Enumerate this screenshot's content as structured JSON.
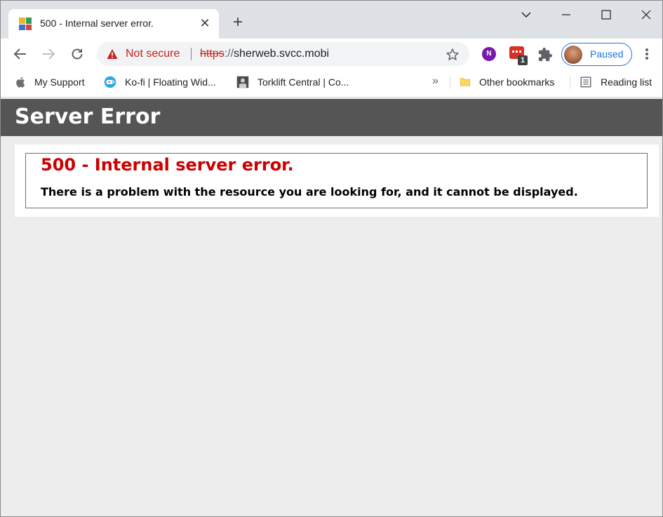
{
  "browser": {
    "tab": {
      "title": "500 - Internal server error.",
      "favicon_colors": [
        "#e8b62e",
        "#2f9b58",
        "#3e74c2",
        "#d04646"
      ]
    },
    "omnibox": {
      "security_label": "Not secure",
      "url_scheme": "https",
      "url_separator": "://",
      "url_host": "sherweb.svcc.mobi"
    },
    "extensions": {
      "onenote_letter": "N",
      "badge_count": "1"
    },
    "profile": {
      "label": "Paused"
    },
    "bookmarks": {
      "items": [
        {
          "label": "My Support"
        },
        {
          "label": "Ko-fi | Floating Wid..."
        },
        {
          "label": "Torklift Central | Co..."
        }
      ],
      "overflow_label": "»",
      "other_label": "Other bookmarks",
      "reading_list_label": "Reading list"
    }
  },
  "page": {
    "header_title": "Server Error",
    "error_heading": "500 - Internal server error.",
    "error_message": "There is a problem with the resource you are looking for, and it cannot be displayed."
  },
  "colors": {
    "header_bg": "#555555",
    "error_red": "#cc0000",
    "not_secure_red": "#c5221f",
    "profile_blue": "#1a73e8"
  }
}
